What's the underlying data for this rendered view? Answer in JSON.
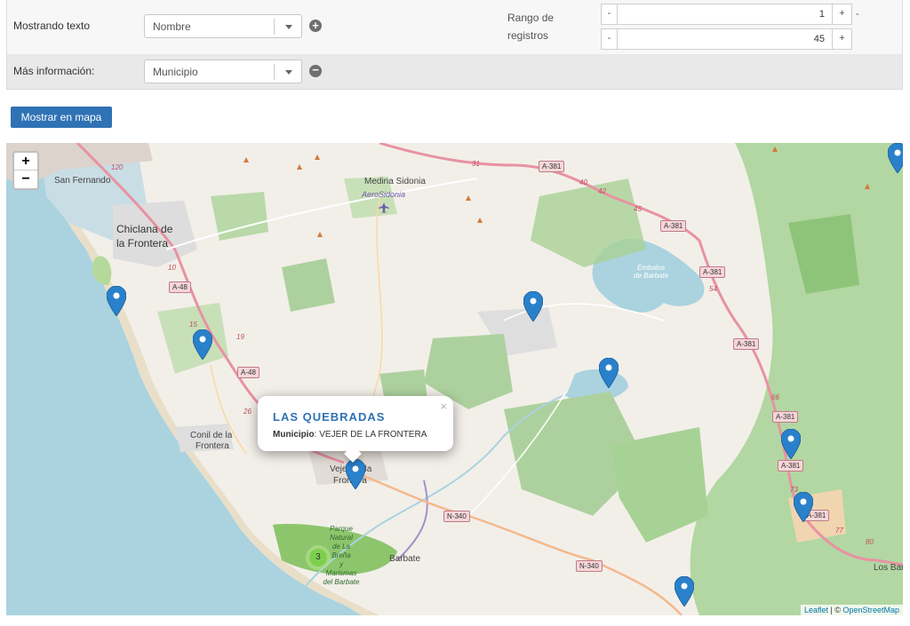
{
  "controls": {
    "row1_label": "Mostrando texto",
    "row1_select": "Nombre",
    "row2_label": "Más información:",
    "row2_select": "Municipio",
    "add_symbol": "+",
    "remove_symbol": "−",
    "range_label_1": "Rango de",
    "range_label_2": "registros",
    "range_from": "1",
    "range_to": "45",
    "minus": "-",
    "plus": "+",
    "dash": "-"
  },
  "button": {
    "show_map": "Mostrar en mapa"
  },
  "map": {
    "zoom_in": "+",
    "zoom_out": "−",
    "attribution_leaflet": "Leaflet",
    "attribution_sep": " | © ",
    "attribution_osm": "OpenStreetMap",
    "cluster_count": "3",
    "popup": {
      "title": "LAS QUEBRADAS",
      "field_label": "Municipio",
      "field_value": ": VEJER DE LA FRONTERA",
      "close": "×"
    },
    "places": {
      "san_fernando": "San Fernando",
      "chiclana_1": "Chiclana de",
      "chiclana_2": "la Frontera",
      "medina": "Medina Sidonia",
      "aero": "AeroSidonia",
      "conil_1": "Conil de la",
      "conil_2": "Frontera",
      "vejer_1": "Vejer de la",
      "vejer_2": "Frontera",
      "barbate": "Barbate",
      "los_bar": "Los Bar",
      "embalse_1": "Embalse",
      "embalse_2": "de Barbate",
      "parque_1": "Parque",
      "parque_2": "Natural",
      "parque_3": "de La",
      "parque_4": "Breña",
      "parque_5": "y",
      "parque_6": "Marismas",
      "parque_7": "del Barbate"
    },
    "roads": {
      "a381": "A-381",
      "a48": "A-48",
      "n340": "N-340"
    },
    "km": [
      "31",
      "40",
      "42",
      "45",
      "54",
      "66",
      "73",
      "77",
      "80",
      "10",
      "15",
      "19",
      "26",
      "120"
    ],
    "icons": [
      "marker-icon",
      "zoom-in-icon",
      "zoom-out-icon",
      "close-icon",
      "plus-circle-icon",
      "minus-circle-icon",
      "caret-down-icon",
      "airport-icon"
    ]
  },
  "colors": {
    "accent": "#2f72b5",
    "marker": "#2a81cb",
    "road": "#e892a2",
    "forest": "#a7d295",
    "water": "#aad3df"
  }
}
